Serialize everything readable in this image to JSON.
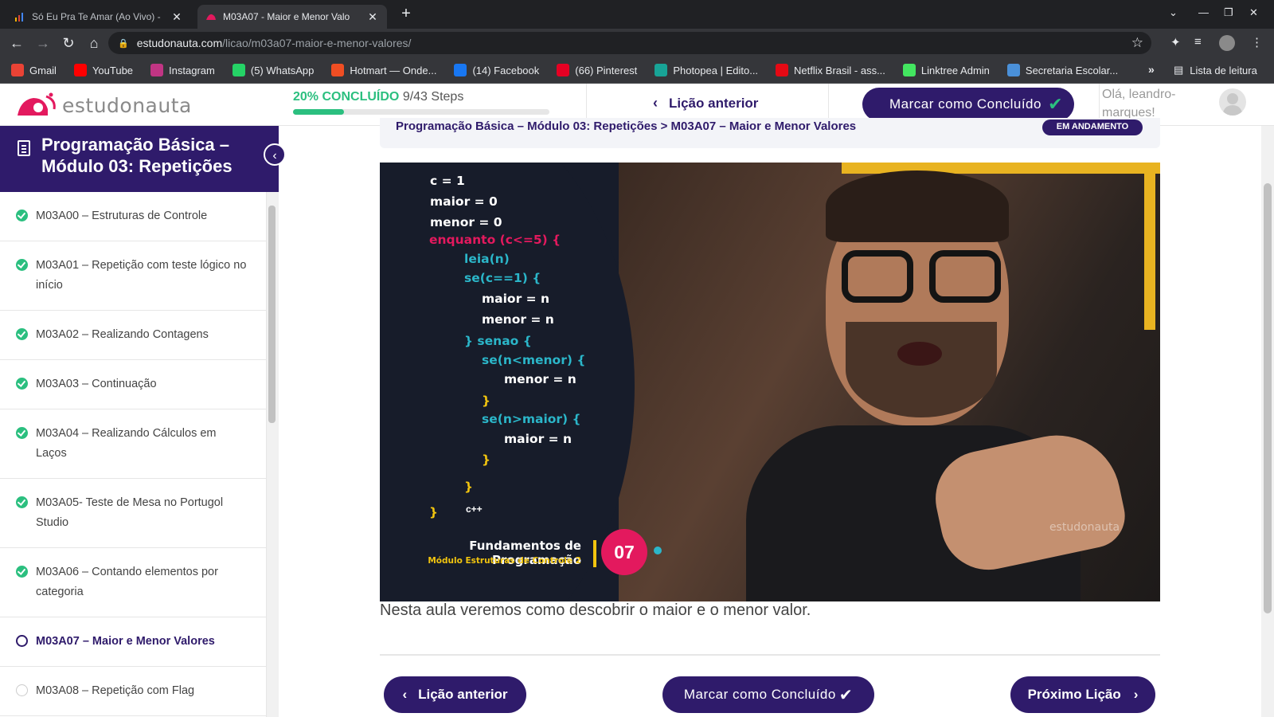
{
  "browser": {
    "tabs": [
      {
        "label": "Só Eu Pra Te Amar (Ao Vivo) - ",
        "active": false
      },
      {
        "label": "M03A07 - Maior e Menor Valo",
        "active": true
      }
    ],
    "url_host": "estudonauta.com",
    "url_path": "/licao/m03a07-maior-e-menor-valores/",
    "bookmarks": [
      {
        "label": "Gmail",
        "icon": "gmail-icon",
        "color": "#ea4335"
      },
      {
        "label": "YouTube",
        "icon": "youtube-icon",
        "color": "#ff0000"
      },
      {
        "label": "Instagram",
        "icon": "instagram-icon",
        "color": "#c13584"
      },
      {
        "label": "(5) WhatsApp",
        "icon": "whatsapp-icon",
        "color": "#25d366"
      },
      {
        "label": "Hotmart — Onde...",
        "icon": "hotmart-icon",
        "color": "#f04e23"
      },
      {
        "label": "(14) Facebook",
        "icon": "facebook-icon",
        "color": "#1877f2"
      },
      {
        "label": "(66) Pinterest",
        "icon": "pinterest-icon",
        "color": "#e60023"
      },
      {
        "label": "Photopea | Edito...",
        "icon": "photopea-icon",
        "color": "#18a497"
      },
      {
        "label": "Netflix Brasil - ass...",
        "icon": "netflix-icon",
        "color": "#e50914"
      },
      {
        "label": "Linktree Admin",
        "icon": "linktree-icon",
        "color": "#43e660"
      },
      {
        "label": "Secretaria Escolar...",
        "icon": "school-icon",
        "color": "#4a90d9"
      }
    ],
    "more_label": "»",
    "reading_list": "Lista de leitura"
  },
  "header": {
    "logo_text": "estudonauta",
    "progress_pct": "20% CONCLUÍDO",
    "progress_steps": "9/43 Steps",
    "progress_fraction": 0.2,
    "prev_label": "Lição anterior",
    "complete_label": "Marcar como Concluído",
    "greeting": "Olá, leandro-marques!"
  },
  "sidebar": {
    "title": "Programação Básica – Módulo 03: Repetições",
    "lessons": [
      {
        "label": "M03A00 – Estruturas de Controle",
        "status": "done"
      },
      {
        "label": "M03A01 – Repetição com teste lógico no início",
        "status": "done"
      },
      {
        "label": "M03A02 – Realizando Contagens",
        "status": "done"
      },
      {
        "label": "M03A03 – Continuação",
        "status": "done"
      },
      {
        "label": "M03A04 – Realizando Cálculos em Laços",
        "status": "done"
      },
      {
        "label": "M03A05- Teste de Mesa no Portugol Studio",
        "status": "done"
      },
      {
        "label": "M03A06 – Contando elementos por categoria",
        "status": "done"
      },
      {
        "label": "M03A07 – Maior e Menor Valores",
        "status": "current"
      },
      {
        "label": "M03A08 – Repetição com Flag",
        "status": "todo"
      }
    ]
  },
  "main": {
    "breadcrumb": "Programação Básica – Módulo 03: Repetições > M03A07 – Maior e Menor Valores",
    "badge": "EM ANDAMENTO",
    "video": {
      "code": [
        "c = 1",
        "maior = 0",
        "menor = 0",
        "enquanto (c<=5) {",
        "leia(n)",
        "se(c==1) {",
        "maior = n",
        "menor = n",
        "} senao {",
        "se(n<menor) {",
        "menor = n",
        "}",
        "se(n>maior) {",
        "maior = n",
        "}",
        "}",
        "}"
      ],
      "cpp": "c++",
      "title": "Fundamentos de Programação",
      "subtitle": "Módulo Estruturas de Controle 2",
      "number": "07",
      "watermark": "estudonauta"
    },
    "description": "Nesta aula veremos como descobrir o maior e o menor valor.",
    "buttons": {
      "prev": "Lição anterior",
      "complete": "Marcar como Concluído",
      "next": "Próximo Lição"
    }
  }
}
